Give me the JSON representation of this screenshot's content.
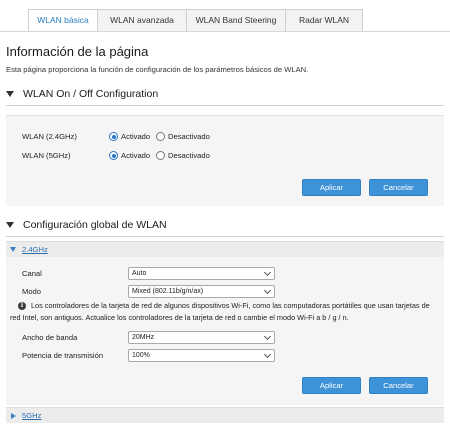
{
  "tabs": [
    {
      "label": "WLAN básica",
      "active": true
    },
    {
      "label": "WLAN avanzada",
      "active": false
    },
    {
      "label": "WLAN Band Steering",
      "active": false
    },
    {
      "label": "Radar WLAN",
      "active": false
    }
  ],
  "page": {
    "title": "Información de la página",
    "description": "Esta página proporciona la función de configuración de los parámetros básicos de WLAN."
  },
  "wlan_onoff": {
    "header": "WLAN On / Off Configuration",
    "rows": [
      {
        "label": "WLAN (2.4GHz)",
        "on_label": "Activado",
        "off_label": "Desactivado",
        "value": "on"
      },
      {
        "label": "WLAN (5GHz)",
        "on_label": "Activado",
        "off_label": "Desactivado",
        "value": "on"
      }
    ],
    "apply_label": "Aplicar",
    "cancel_label": "Cancelar"
  },
  "global": {
    "header": "Configuración global de WLAN",
    "band_24": {
      "title": "2.4GHz",
      "canal_label": "Canal",
      "canal_value": "Auto",
      "modo_label": "Modo",
      "modo_value": "Mixed (802.11b/g/n/ax)",
      "info_line1": "Los controladores de la tarjeta de red de algunos dispositivos Wi-Fi, como las computadoras portátiles que usan tarjetas de",
      "info_line2": "red Intel, son antiguos. Actualice los controladores de la tarjeta de red o cambie el modo Wi-Fi a b / g / n.",
      "bandwidth_label": "Ancho de banda",
      "bandwidth_value": "20MHz",
      "power_label": "Potencia de transmisión",
      "power_value": "100%",
      "apply_label": "Aplicar",
      "cancel_label": "Cancelar"
    },
    "band_5": {
      "title": "5GHz"
    }
  },
  "colors": {
    "accent": "#3d92d8",
    "link": "#2a6fb0",
    "panel_bg": "#f5f5f5"
  },
  "icons": {
    "info": "info-icon",
    "section_toggle": "triangle-down-icon",
    "band_expanded": "triangle-down-icon",
    "band_collapsed": "triangle-right-icon"
  }
}
